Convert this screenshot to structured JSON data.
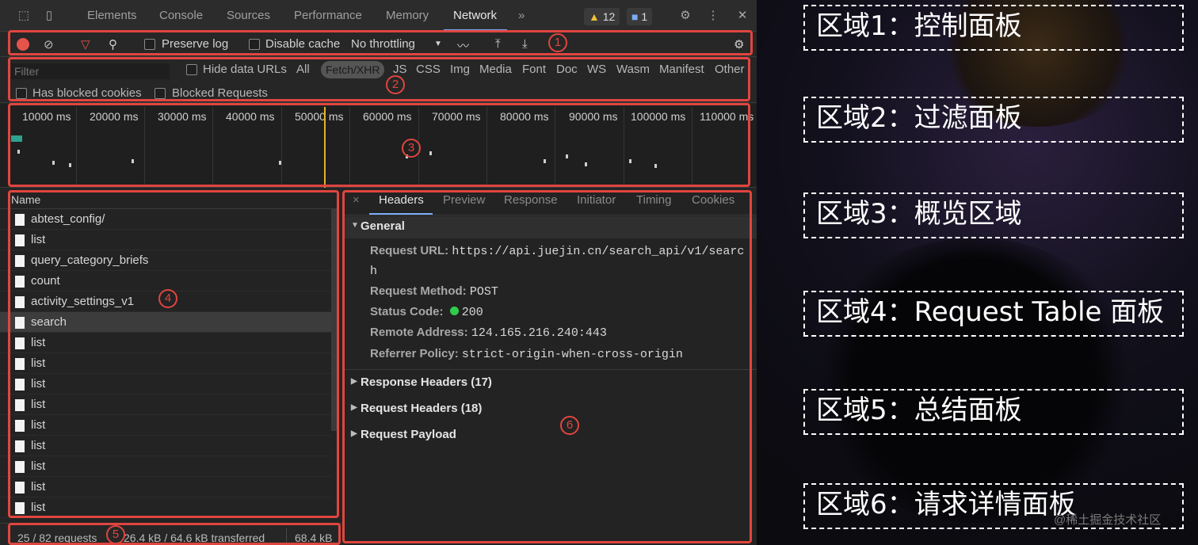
{
  "devtools": {
    "tabs": [
      "Elements",
      "Console",
      "Sources",
      "Performance",
      "Memory",
      "Network"
    ],
    "more_tabs": "»",
    "warn_count": "12",
    "msg_count": "1",
    "toolbar": {
      "preserve_log": "Preserve log",
      "disable_cache": "Disable cache",
      "throttling": "No throttling",
      "area_num": "1"
    },
    "filter": {
      "placeholder": "Filter",
      "hide_data_urls": "Hide data URLs",
      "types": [
        "All",
        "Fetch/XHR",
        "JS",
        "CSS",
        "Img",
        "Media",
        "Font",
        "Doc",
        "WS",
        "Wasm",
        "Manifest",
        "Other"
      ],
      "has_blocked_cookies": "Has blocked cookies",
      "blocked_requests": "Blocked Requests",
      "area_num": "2"
    },
    "overview": {
      "labels": [
        "10000 ms",
        "20000 ms",
        "30000 ms",
        "40000 ms",
        "50000 ms",
        "60000 ms",
        "70000 ms",
        "80000 ms",
        "90000 ms",
        "100000 ms",
        "110000 ms"
      ],
      "area_num": "3"
    },
    "request_table": {
      "header": "Name",
      "rows": [
        "abtest_config/",
        "list",
        "query_category_briefs",
        "count",
        "activity_settings_v1",
        "search",
        "list",
        "list",
        "list",
        "list",
        "list",
        "list",
        "list",
        "list",
        "list"
      ],
      "selected_index": 5,
      "area_num": "4"
    },
    "status": {
      "requests": "25 / 82 requests",
      "transferred": "26.4 kB / 64.6 kB transferred",
      "resources": "68.4 kB",
      "area_num": "5"
    },
    "details": {
      "close": "×",
      "tabs": [
        "Headers",
        "Preview",
        "Response",
        "Initiator",
        "Timing",
        "Cookies"
      ],
      "general_title": "General",
      "request_url_label": "Request URL:",
      "request_url_line1": "https://api.juejin.cn/search_api/v1/searc",
      "request_url_line2": "h",
      "request_method_label": "Request Method:",
      "request_method": "POST",
      "status_code_label": "Status Code:",
      "status_code": "200",
      "remote_address_label": "Remote Address:",
      "remote_address": "124.165.216.240:443",
      "referrer_policy_label": "Referrer Policy:",
      "referrer_policy": "strict-origin-when-cross-origin",
      "response_headers": "Response Headers (17)",
      "request_headers": "Request Headers (18)",
      "request_payload": "Request Payload",
      "area_num": "6"
    }
  },
  "annotations": [
    "区域1：控制面板",
    "区域2：过滤面板",
    "区域3：概览区域",
    "区域4：Request Table 面板",
    "区域5：总结面板",
    "区域6：请求详情面板"
  ],
  "watermark": "@稀土掘金技术社区",
  "colors": {
    "highlight_red": "#e0453f",
    "accent_blue": "#7cacf8",
    "status_green": "#2fcd4a"
  }
}
